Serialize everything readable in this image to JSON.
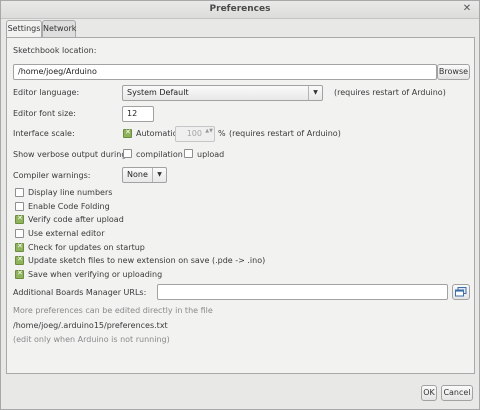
{
  "window": {
    "title": "Preferences",
    "close_glyph": "✕"
  },
  "tabs": [
    {
      "label": "Settings"
    },
    {
      "label": "Network"
    }
  ],
  "settings": {
    "sketchbook_label": "Sketchbook location:",
    "sketchbook_value": "/home/joeg/Arduino",
    "browse_label": "Browse",
    "language_label": "Editor language:",
    "language_value": "System Default",
    "language_note": "(requires restart of Arduino)",
    "font_size_label": "Editor font size:",
    "font_size_value": "12",
    "scale_label": "Interface scale:",
    "scale_auto_label": "Automatic",
    "scale_value": "100",
    "scale_unit": "%",
    "scale_note": "(requires restart of Arduino)",
    "verbose_label": "Show verbose output during:",
    "verbose_compilation": "compilation",
    "verbose_upload": "upload",
    "warnings_label": "Compiler warnings:",
    "warnings_value": "None",
    "checkboxes": [
      {
        "label": "Display line numbers",
        "checked": false
      },
      {
        "label": "Enable Code Folding",
        "checked": false
      },
      {
        "label": "Verify code after upload",
        "checked": true
      },
      {
        "label": "Use external editor",
        "checked": false
      },
      {
        "label": "Check for updates on startup",
        "checked": true
      },
      {
        "label": "Update sketch files to new extension on save (.pde -> .ino)",
        "checked": true
      },
      {
        "label": "Save when verifying or uploading",
        "checked": true
      }
    ],
    "boards_label": "Additional Boards Manager URLs:",
    "boards_value": "",
    "more_prefs_note": "More preferences can be edited directly in the file",
    "prefs_path": "/home/joeg/.arduino15/preferences.txt",
    "edit_note": "(edit only when Arduino is not running)"
  },
  "footer": {
    "ok_label": "OK",
    "cancel_label": "Cancel"
  },
  "colors": {
    "check_on": "#8fb35a",
    "window_bg": "#e8e8e7"
  },
  "icons": {
    "arrow": "▼",
    "spin_updown": "▲▼",
    "boards_edit": "window-stack-icon"
  }
}
